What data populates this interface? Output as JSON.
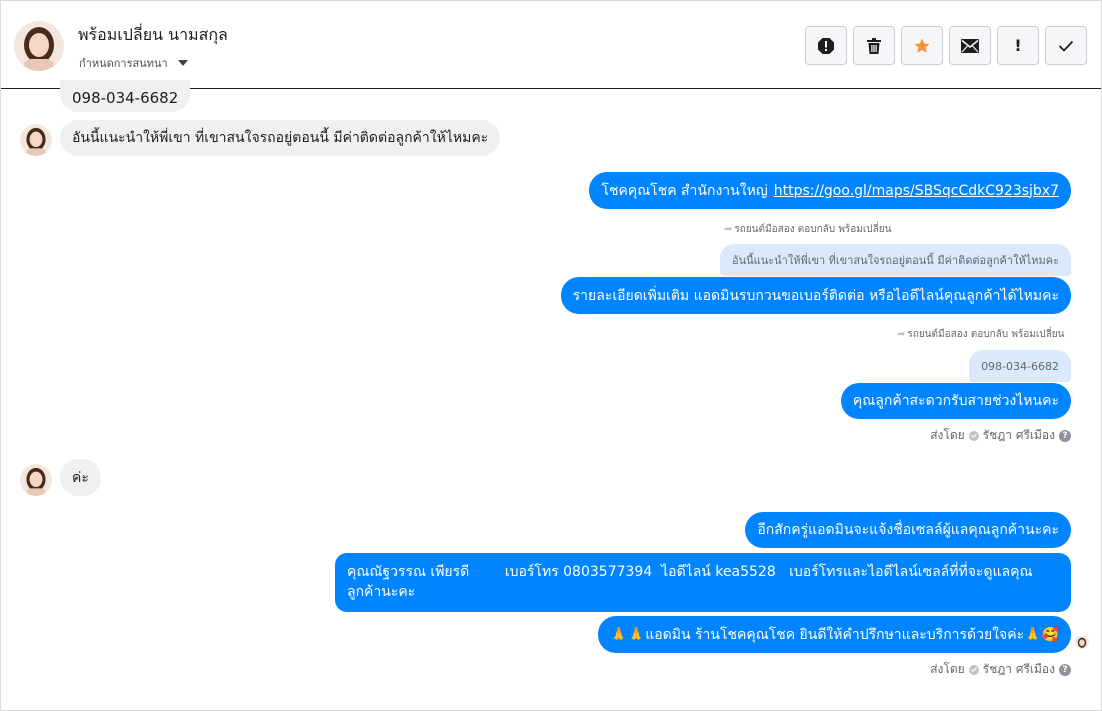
{
  "header": {
    "contact_name": "พร้อมเปลี่ยน นามสกุล",
    "assign_label": "กำหนดการสนทนา",
    "toolbar_icons": [
      "spam-icon",
      "trash-icon",
      "star-icon",
      "mail-icon",
      "important-icon",
      "check-icon"
    ],
    "toolbar_important_glyph": "!",
    "star_color": "#f7923a"
  },
  "colors": {
    "outgoing_bubble": "#0084ff",
    "incoming_bubble": "#f0f0f0",
    "quote_bubble": "#dae9fb"
  },
  "messages": [
    {
      "direction": "in",
      "text": "098-034-6682"
    },
    {
      "direction": "in",
      "text": "อันนี้แนะนำให้พี่เขา ที่เขาสนใจรถอยู่ตอนนี้ มีค่าติดต่อลูกค้าให้ไหมคะ"
    },
    {
      "direction": "out",
      "text": "โชคคุณโชค สำนักงานใหญ่",
      "link": "https://goo.gl/maps/SBSqcCdkC923sjbx7"
    },
    {
      "direction": "out",
      "reply_tag": "รถยนต์มือสอง ตอบกลับ พร้อมเปลี่ยน",
      "quote": "อันนี้แนะนำให้พี่เขา ที่เขาสนใจรถอยู่ตอนนี้ มีค่าติดต่อลูกค้าให้ไหมคะ",
      "text": "รายละเอียดเพิ่มเติม แอดมินรบกวนขอเบอร์ติดต่อ หรือไอดีไลน์คุณลูกค้าได้ไหมคะ"
    },
    {
      "direction": "out",
      "reply_tag": "รถยนต์มือสอง ตอบกลับ พร้อมเปลี่ยน",
      "quote": "098-034-6682",
      "text": "คุณลูกค้าสะดวกรับสายช่วงไหนคะ"
    },
    {
      "direction": "in",
      "text": "ค่ะ"
    },
    {
      "direction": "out",
      "text": "อีกสักครู่แอดมินจะแจ้งชื่อเซลล์ผู้แลคุณลูกค้านะคะ"
    },
    {
      "direction": "out",
      "text": "คุณณัฐวรรณ เพียรดี        เบอร์โทร 0803577394  ไอดีไลน์ kea5528   เบอร์โทรและไอดีไลน์เซลล์ที่ที่จะดูแลคุณลูกค้านะคะ"
    },
    {
      "direction": "out",
      "text": "🙏🙏แอดมิน ร้านโชคคุณโชค ยินดีให้คำปรึกษาและบริการด้วยใจค่ะ🙏🥰"
    }
  ],
  "sent_by": {
    "prefix": "ส่งโดย",
    "name": "รัชฎา ศรีเมือง"
  }
}
